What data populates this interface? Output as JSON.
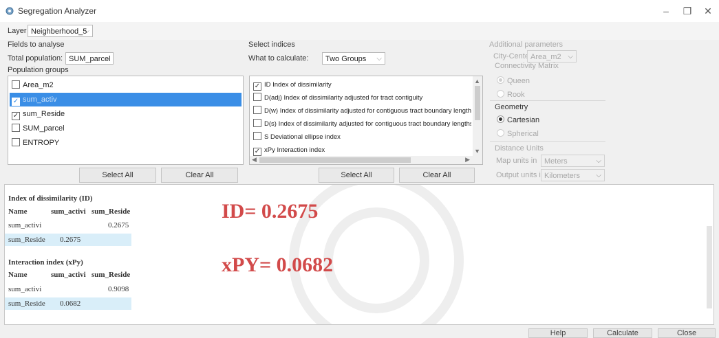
{
  "window": {
    "title": "Segregation Analyzer",
    "minimize_glyph": "–",
    "maximize_glyph": "❐",
    "close_glyph": "✕",
    "icon": "gear-icon"
  },
  "layer": {
    "label": "Layer",
    "value": "Neighberhood_5"
  },
  "fields": {
    "section_title": "Fields to analyse",
    "total_label": "Total population:",
    "total_value": "SUM_parcel",
    "groups_label": "Population groups",
    "items": [
      {
        "label": "Area_m2",
        "checked": false,
        "selected": false
      },
      {
        "label": "sum_activ",
        "checked": true,
        "selected": true
      },
      {
        "label": "sum_Reside",
        "checked": true,
        "selected": false
      },
      {
        "label": "SUM_parcel",
        "checked": false,
        "selected": false
      },
      {
        "label": "ENTROPY",
        "checked": false,
        "selected": false
      }
    ],
    "select_all": "Select All",
    "clear_all": "Clear All"
  },
  "indices": {
    "section_title": "Select indices",
    "calc_label": "What to calculate:",
    "calc_value": "Two Groups",
    "items": [
      {
        "label": "ID Index of dissimilarity",
        "checked": true
      },
      {
        "label": "D(adj) Index of dissimilarity adjusted for tract contiguity",
        "checked": false
      },
      {
        "label": "D(w) Index of dissimilarity adjusted for contiguous tract boundary lengths",
        "checked": false
      },
      {
        "label": "D(s) Index of dissimilarity adjusted for contiguous tract boundary lengths a",
        "checked": false
      },
      {
        "label": "S Deviational ellipse index",
        "checked": false
      },
      {
        "label": "xPy Interaction index",
        "checked": true
      }
    ],
    "select_all": "Select All",
    "clear_all": "Clear All"
  },
  "params": {
    "section_title": "Additional parameters",
    "city_center_label": "City-Center",
    "city_center_value": "Area_m2",
    "connectivity_title": "Connectivity Matrix",
    "queen": "Queen",
    "rook": "Rook",
    "geometry_title": "Geometry",
    "cartesian": "Cartesian",
    "spherical": "Spherical",
    "distance_title": "Distance Units",
    "map_units_label": "Map units in",
    "map_units_value": "Meters",
    "output_units_label": "Output units in",
    "output_units_value": "Kilometers"
  },
  "results": {
    "dissim": {
      "title": "Index of dissimilarity (ID)",
      "headers": [
        "Name",
        "sum_activi",
        "sum_Reside"
      ],
      "rows": [
        {
          "name": "sum_activi",
          "v1": "",
          "v2": "0.2675"
        },
        {
          "name": "sum_Reside",
          "v1": "0.2675",
          "v2": ""
        }
      ]
    },
    "interaction": {
      "title": "Interaction index (xPy)",
      "headers": [
        "Name",
        "sum_activi",
        "sum_Reside"
      ],
      "rows": [
        {
          "name": "sum_activi",
          "v1": "",
          "v2": "0.9098"
        },
        {
          "name": "sum_Reside",
          "v1": "0.0682",
          "v2": ""
        }
      ]
    },
    "id_annotation": "ID= 0.2675",
    "xpy_annotation": "xPY= 0.0682"
  },
  "footer": {
    "help": "Help",
    "calculate": "Calculate",
    "close": "Close"
  },
  "colors": {
    "accent": "#3a8ee6",
    "annotation": "#d24a4a",
    "highlight_row": "#d9eef9"
  }
}
